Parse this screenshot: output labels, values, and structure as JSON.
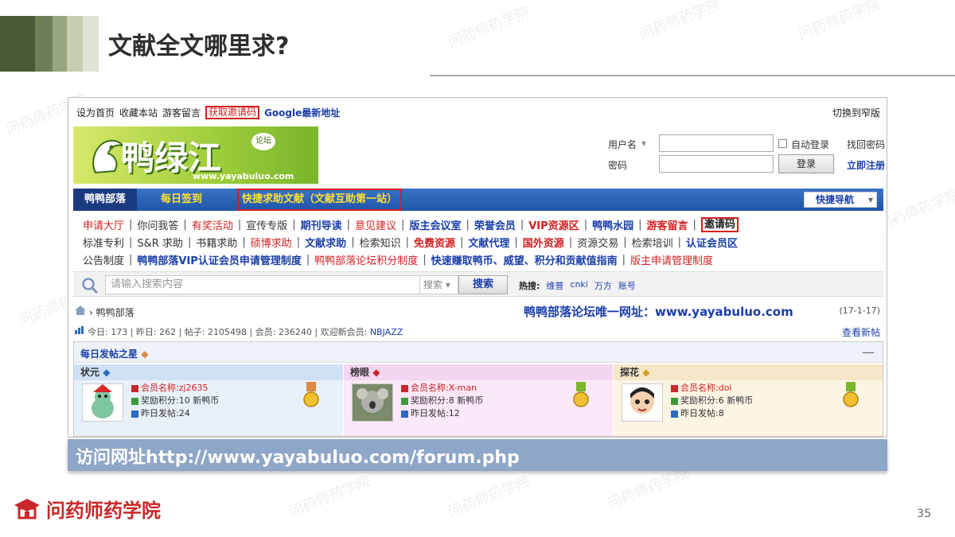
{
  "slide": {
    "title": "文献全文哪里求?",
    "banner": "访问网址http://www.yayabuluo.com/forum.php",
    "footer_brand": "问药师药学院",
    "page_number": "35",
    "watermark": "问药师药学院"
  },
  "forum": {
    "topbar": {
      "links": [
        "设为首页",
        "收藏本站",
        "游客留言"
      ],
      "invite_code": "获取邀请码",
      "google": "Google最新地址",
      "switch": "切换到窄版"
    },
    "logo": {
      "mark": "鸭绿江",
      "badge": "论坛",
      "url": "www.yayabuluo.com"
    },
    "login": {
      "username_label": "用户名",
      "password_label": "密码",
      "auto_login": "自动登录",
      "find_password": "找回密码",
      "login_button": "登录",
      "register": "立即注册"
    },
    "nav": {
      "home": "鸭鸭部落",
      "checkin": "每日签到",
      "quick_help": "快捷求助文献（文献互助第一站）",
      "quick_nav": "快捷导航"
    },
    "menu": {
      "row1": [
        {
          "t": "申请大厅",
          "c": "red"
        },
        {
          "t": "你问我答",
          "c": "black"
        },
        {
          "t": "有奖活动",
          "c": "red"
        },
        {
          "t": "宣传专版",
          "c": "black"
        },
        {
          "t": "期刊导读",
          "c": "blue"
        },
        {
          "t": "意见建议",
          "c": "red"
        },
        {
          "t": "版主会议室",
          "c": "blue"
        },
        {
          "t": "荣誉会员",
          "c": "blue"
        },
        {
          "t": "VIP资源区",
          "c": "boldred"
        },
        {
          "t": "鸭鸭水园",
          "c": "blue"
        },
        {
          "t": "游客留言",
          "c": "boldred"
        },
        {
          "t": "邀请码",
          "c": "boxed"
        }
      ],
      "row2": [
        {
          "t": "标准专利",
          "c": "black"
        },
        {
          "t": "S&R 求助",
          "c": "black"
        },
        {
          "t": "书籍求助",
          "c": "black"
        },
        {
          "t": "硕博求助",
          "c": "red"
        },
        {
          "t": "文献求助",
          "c": "blue"
        },
        {
          "t": "检索知识",
          "c": "black"
        },
        {
          "t": "免费资源",
          "c": "boldred"
        },
        {
          "t": "文献代理",
          "c": "blue"
        },
        {
          "t": "国外资源",
          "c": "boldred"
        },
        {
          "t": "资源交易",
          "c": "black"
        },
        {
          "t": "检索培训",
          "c": "black"
        },
        {
          "t": "认证会员区",
          "c": "blue"
        }
      ],
      "row3": [
        {
          "t": "公告制度",
          "c": "black"
        },
        {
          "t": "鸭鸭部落VIP认证会员申请管理制度",
          "c": "blue"
        },
        {
          "t": "鸭鸭部落论坛积分制度",
          "c": "red"
        },
        {
          "t": "快速赚取鸭币、威望、积分和贡献值指南",
          "c": "blue"
        },
        {
          "t": "版主申请管理制度",
          "c": "red"
        }
      ]
    },
    "search": {
      "placeholder": "请输入搜索内容",
      "type": "搜索",
      "button": "搜索",
      "hot_label": "热搜:",
      "hot": [
        "维普",
        "cnki",
        "万方",
        "账号"
      ]
    },
    "breadcrumb": {
      "path": "鸭鸭部落",
      "site_notice": "鸭鸭部落论坛唯一网址：www.yayabuluo.com",
      "date": "(17-1-17)"
    },
    "stats": {
      "today": "今日: 173",
      "yesterday": "昨日: 262",
      "posts": "帖子: 2105498",
      "members": "会员: 236240",
      "welcome": "欢迎新会员:",
      "new_member": "NBJAZZ",
      "view_new": "查看新帖"
    },
    "stars": {
      "title": "每日发帖之星",
      "columns": [
        {
          "rank": "状元",
          "name": "会员名称:zj2635",
          "points": "奖励积分:10 新鸭币",
          "posts": "昨日发帖:24",
          "bg": "#cfe2f5",
          "body": "#e8f1fa"
        },
        {
          "rank": "榜眼",
          "name": "会员名称:X-man",
          "points": "奖励积分:8 新鸭币",
          "posts": "昨日发帖:12",
          "bg": "#f4d6f0",
          "body": "#fbe8f8"
        },
        {
          "rank": "探花",
          "name": "会员名称:doi",
          "points": "奖励积分:6 新鸭币",
          "posts": "昨日发帖:8",
          "bg": "#f7e6c8",
          "body": "#fdf4e4"
        }
      ]
    }
  }
}
